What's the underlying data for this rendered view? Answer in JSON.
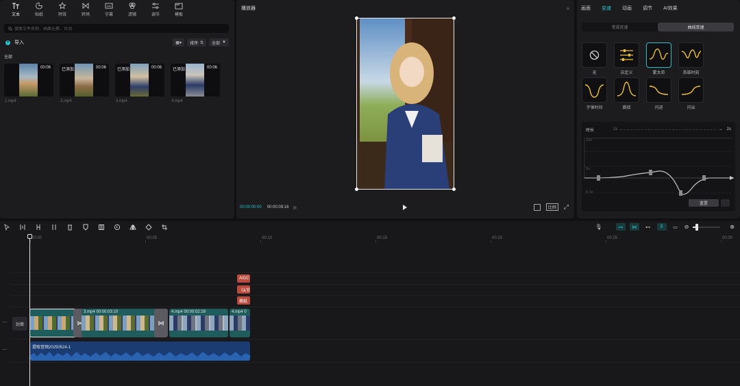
{
  "toolbar_tabs": [
    {
      "label": "文本",
      "icon": "text-icon"
    },
    {
      "label": "贴纸",
      "icon": "sticker-icon"
    },
    {
      "label": "特效",
      "icon": "effects-icon"
    },
    {
      "label": "转场",
      "icon": "transition-icon"
    },
    {
      "label": "字幕",
      "icon": "subtitle-icon"
    },
    {
      "label": "滤镜",
      "icon": "filter-icon"
    },
    {
      "label": "调节",
      "icon": "adjust-icon"
    },
    {
      "label": "模板",
      "icon": "template-icon"
    }
  ],
  "media": {
    "search_placeholder": "搜索文件名称、画面元素、台词",
    "import_label": "导入",
    "sort_label": "排序",
    "filter_label": "全部",
    "all_label": "全部",
    "items": [
      {
        "name": "1.mp4",
        "duration": "00:06",
        "added": ""
      },
      {
        "name": "2.mp4",
        "duration": "00:06",
        "added": "已添加"
      },
      {
        "name": "3.mp4",
        "duration": "00:06",
        "added": "已添加"
      },
      {
        "name": "4.mp4",
        "duration": "00:06",
        "added": "已添加"
      }
    ]
  },
  "player": {
    "title": "播放器",
    "current_time": "00:00:00:00",
    "total_time": "00:00:09:16",
    "ratio_label": "比例"
  },
  "inspector": {
    "tabs": [
      "画面",
      "变速",
      "动画",
      "调节",
      "AI效果"
    ],
    "active_tab": "变速",
    "modes": [
      "常规变速",
      "曲线变速"
    ],
    "active_mode": "曲线变速",
    "presets": [
      {
        "label": "无",
        "icon": "none-icon"
      },
      {
        "label": "自定义",
        "icon": "custom-sliders-icon"
      },
      {
        "label": "蒙太奇",
        "icon": "montage-curve-icon"
      },
      {
        "label": "英雄时刻",
        "icon": "hero-curve-icon"
      },
      {
        "label": "子弹时间",
        "icon": "bullet-curve-icon"
      },
      {
        "label": "跳接",
        "icon": "jump-curve-icon"
      },
      {
        "label": "闪进",
        "icon": "flash-in-curve-icon"
      },
      {
        "label": "闪出",
        "icon": "flash-out-curve-icon"
      }
    ],
    "selected_preset": "蒙太奇",
    "duration_label": "时长",
    "duration_from": "2s",
    "duration_to": "2s",
    "y_top": "10x",
    "y_mid": "1x",
    "y_bottom": "0.1x",
    "reset_label": "重置"
  },
  "timeline": {
    "ruler": [
      "00:00",
      "00:05",
      "00:10",
      "00:15",
      "00:20",
      "00:25",
      "00:30"
    ],
    "text_chips": [
      "AIGC",
      "《&节",
      "撕纸"
    ],
    "cover_label": "封面",
    "clips": [
      {
        "label": ""
      },
      {
        "label": "3.mp4  00:00:03:10"
      },
      {
        "label": "4.mp4  00:00:02:28"
      },
      {
        "label": "4.mp4  0"
      }
    ],
    "audio_label": "提取音频20250524-1"
  },
  "colors": {
    "accent": "#25c2cc",
    "curve_yellow": "#f2c230",
    "clip_teal": "#1f5d5c",
    "audio_blue": "#1a3c72",
    "text_chip": "#b94a3e"
  }
}
